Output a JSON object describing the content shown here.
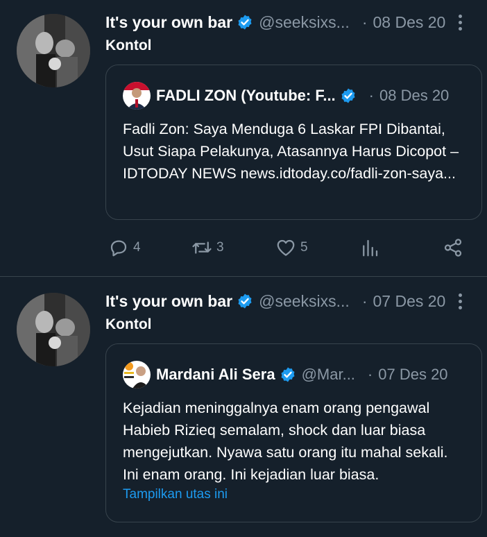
{
  "tweets": [
    {
      "author_name": "It's your own bar",
      "handle": "@seeksixs...",
      "date": "08 Des 20",
      "text": "Kontol",
      "quote": {
        "author_name": "FADLI ZON (Youtube: F...",
        "handle": "",
        "date": "08 Des 20",
        "text": "Fadli Zon: Saya Menduga 6 Laskar FPI Dibantai, Usut Siapa Pelakunya, Atasannya Harus Dicopot – IDTODAY NEWS news.idtoday.co/fadli-zon-saya...",
        "show_thread": ""
      },
      "actions": {
        "replies": "4",
        "retweets": "3",
        "likes": "5"
      }
    },
    {
      "author_name": "It's your own bar",
      "handle": "@seeksixs...",
      "date": "07 Des 20",
      "text": "Kontol",
      "quote": {
        "author_name": "Mardani Ali Sera",
        "handle": "@Mar...",
        "date": "07 Des 20",
        "text": "Kejadian meninggalnya enam orang pengawal Habieb Rizieq semalam, shock dan luar biasa mengejutkan. Nyawa satu orang itu mahal sekali. Ini enam orang. Ini kejadian luar biasa.",
        "show_thread": "Tampilkan utas ini"
      }
    }
  ],
  "separator": "·",
  "colors": {
    "background": "#15202b",
    "muted": "#8b98a5",
    "link": "#1d9bf0",
    "verified": "#1d9bf0",
    "border": "#38444d"
  },
  "icons": [
    "verified-badge-icon",
    "more-options-icon",
    "reply-icon",
    "retweet-icon",
    "like-icon",
    "analytics-icon",
    "share-icon"
  ]
}
